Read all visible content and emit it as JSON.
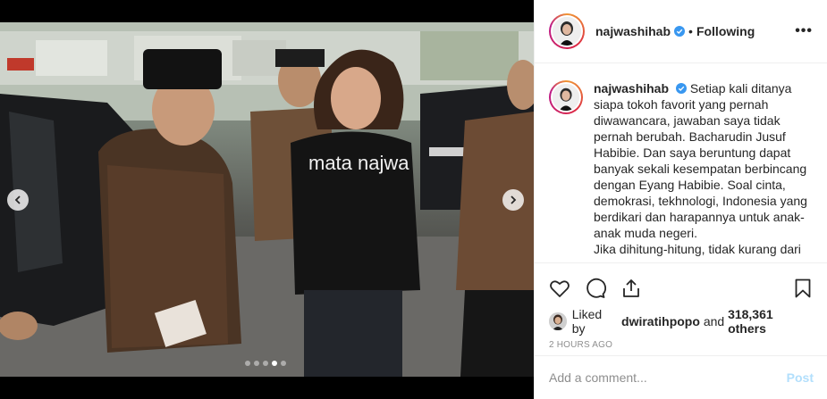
{
  "colors": {
    "accent": "#3897f0",
    "post_disabled": "#b2dffc",
    "muted": "#8e8e8e",
    "text": "#262626"
  },
  "media": {
    "shirt_text": "mata najwa",
    "carousel": {
      "total": 5,
      "active_index": 3
    }
  },
  "header": {
    "username": "najwashihab",
    "separator": "•",
    "follow_status": "Following",
    "more_label": "•••"
  },
  "caption": {
    "username": "najwashihab",
    "text": "Setiap kali ditanya siapa tokoh favorit yang pernah diwawancara, jawaban saya tidak pernah berubah. Bacharudin Jusuf Habibie. Dan saya beruntung dapat banyak sekali kesempatan berbincang dengan Eyang Habibie. Soal cinta, demokrasi, tekhnologi, Indonesia yang berdikari dan harapannya untuk anak-anak muda negeri.\nJika dihitung-hitung, tidak kurang dari"
  },
  "actions": {
    "icons": [
      "heart-icon",
      "comment-icon",
      "share-icon",
      "bookmark-icon"
    ]
  },
  "likes": {
    "prefix": "Liked by",
    "user": "dwiratihpopo",
    "middle": "and",
    "others": "318,361 others"
  },
  "timestamp": "2 HOURS AGO",
  "comment": {
    "placeholder": "Add a comment...",
    "post_label": "Post"
  }
}
